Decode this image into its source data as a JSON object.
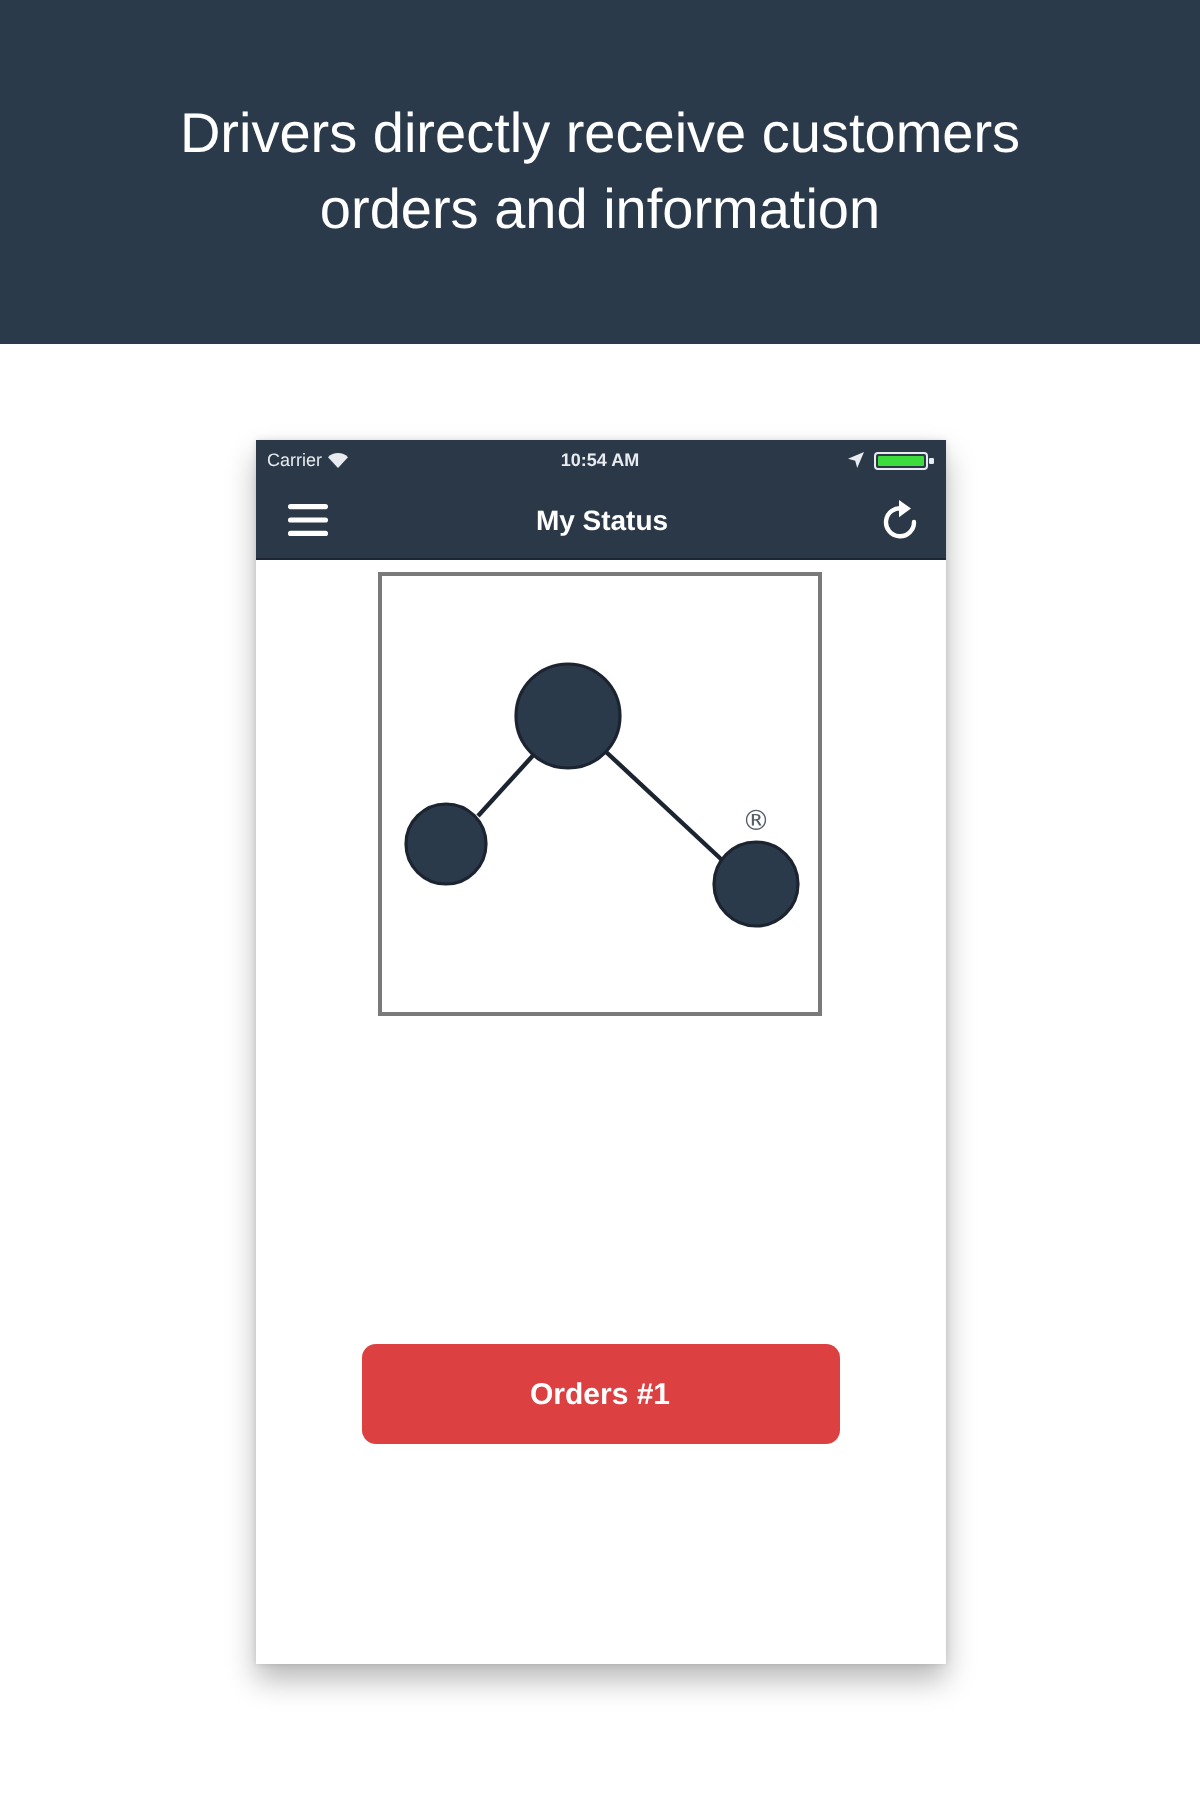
{
  "banner": {
    "headline": "Drivers directly receive customers orders and information"
  },
  "phone": {
    "status_bar": {
      "carrier": "Carrier",
      "time": "10:54 AM"
    },
    "nav_bar": {
      "title": "My Status"
    },
    "logo": {
      "mark": "®"
    },
    "orders_button": {
      "label": "Orders #1"
    }
  }
}
